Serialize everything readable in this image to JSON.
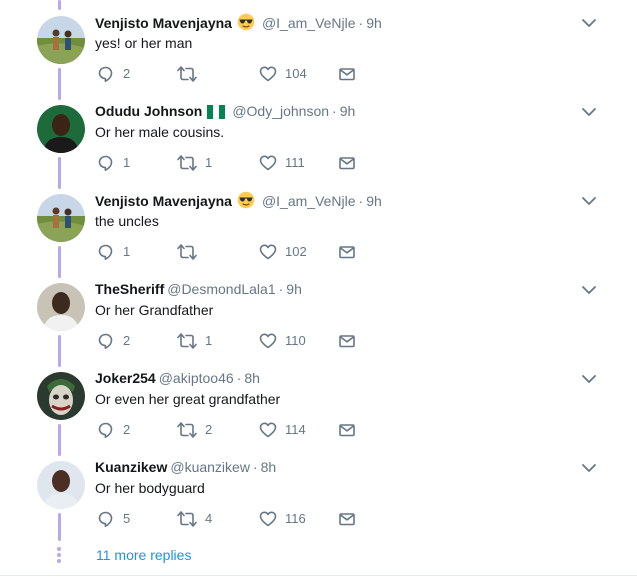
{
  "tweets": [
    {
      "name": "Venjisto Mavenjayna",
      "badge": "sunglasses-emoji",
      "handle": "@I_am_VeNjle",
      "time": "9h",
      "text": "yes! or her man",
      "replies": "2",
      "retweets": "",
      "likes": "104",
      "avatar": {
        "kind": "field",
        "colors": [
          "#6f8f3c",
          "#c7d7e8",
          "#a8703f"
        ]
      }
    },
    {
      "name": "Odudu Johnson",
      "badge": "nigeria-flag",
      "handle": "@Ody_johnson",
      "time": "9h",
      "text": "Or her male cousins.",
      "replies": "1",
      "retweets": "1",
      "likes": "111",
      "avatar": {
        "kind": "portrait",
        "colors": [
          "#1d6a3a",
          "#3b2416",
          "#1a1a1a"
        ]
      }
    },
    {
      "name": "Venjisto Mavenjayna",
      "badge": "sunglasses-emoji",
      "handle": "@I_am_VeNjle",
      "time": "9h",
      "text": "the uncles",
      "replies": "1",
      "retweets": "",
      "likes": "102",
      "avatar": {
        "kind": "field",
        "colors": [
          "#6f8f3c",
          "#c7d7e8",
          "#a8703f"
        ]
      }
    },
    {
      "name": "TheSheriff",
      "badge": "",
      "handle": "@DesmondLala1",
      "time": "9h",
      "text": "Or her Grandfather",
      "replies": "2",
      "retweets": "1",
      "likes": "110",
      "avatar": {
        "kind": "portrait",
        "colors": [
          "#c9c2b6",
          "#3d2a1e",
          "#f1f1f1"
        ]
      }
    },
    {
      "name": "Joker254",
      "badge": "",
      "handle": "@akiptoo46",
      "time": "8h",
      "text": "Or even her great grandfather",
      "replies": "2",
      "retweets": "2",
      "likes": "114",
      "avatar": {
        "kind": "joker",
        "colors": [
          "#2a3a2e",
          "#d9d4c8",
          "#3c6b3a"
        ]
      }
    },
    {
      "name": "Kuanzikew",
      "badge": "",
      "handle": "@kuanzikew",
      "time": "8h",
      "text": "Or her bodyguard",
      "replies": "5",
      "retweets": "4",
      "likes": "116",
      "avatar": {
        "kind": "portrait",
        "colors": [
          "#dfe6ee",
          "#4a2f22",
          "#e9eef3"
        ]
      }
    }
  ],
  "more_replies": "11 more replies",
  "colors": {
    "thread_line": "#b9a8ee",
    "link": "#1b95e0",
    "muted": "#657786"
  }
}
